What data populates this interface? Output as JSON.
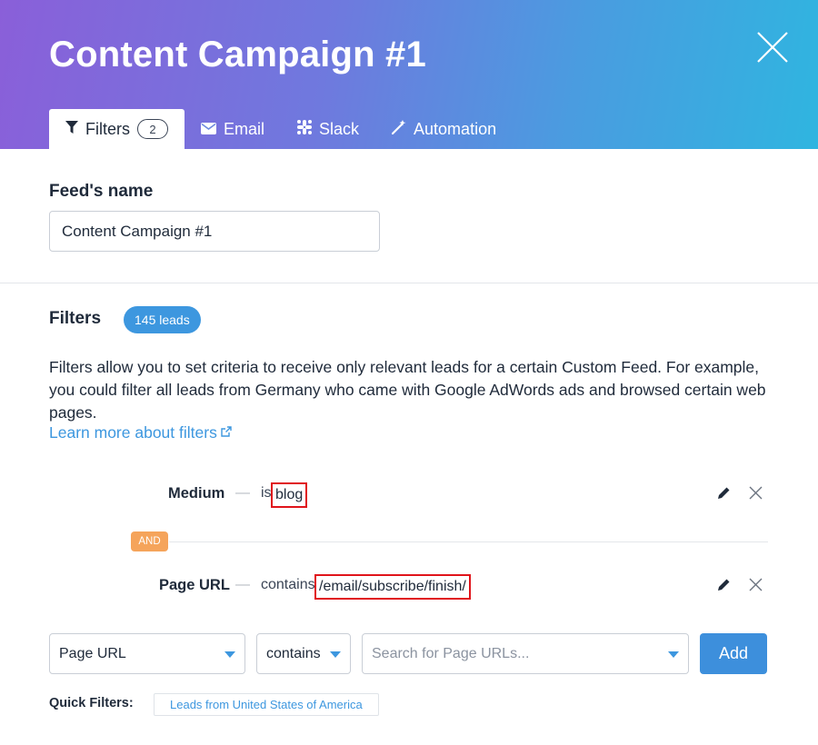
{
  "header": {
    "title": "Content Campaign #1",
    "gradient_colors": [
      "#8a5fd9",
      "#4a9ce0",
      "#2fb5e0"
    ],
    "close_icon": "close-icon"
  },
  "tabs": [
    {
      "label": "Filters",
      "icon": "filter-icon",
      "badge": "2",
      "active": true
    },
    {
      "label": "Email",
      "icon": "envelope-icon",
      "active": false
    },
    {
      "label": "Slack",
      "icon": "slack-icon",
      "active": false
    },
    {
      "label": "Automation",
      "icon": "magic-wand-icon",
      "active": false
    }
  ],
  "feed": {
    "label": "Feed's name",
    "value": "Content Campaign #1"
  },
  "filters": {
    "title": "Filters",
    "leads_badge": "145 leads",
    "description": "Filters allow you to set criteria to receive only relevant leads for a certain Custom Feed. For example, you could filter all leads from Germany who came with Google AdWords ads and browsed certain web pages.",
    "learn_more": "Learn more about filters",
    "rules": [
      {
        "field": "Medium",
        "dash": "—",
        "operator": "is",
        "value": "blog"
      },
      {
        "field": "Page URL",
        "dash": "—",
        "operator": "contains",
        "value": "/email/subscribe/finish/"
      }
    ],
    "connector": "AND"
  },
  "builder": {
    "field_select": "Page URL",
    "operator_select": "contains",
    "search_placeholder": "Search for Page URLs...",
    "add_label": "Add"
  },
  "quick_filters": {
    "label": "Quick Filters:",
    "chips": [
      "Leads from United States of America"
    ]
  },
  "colors": {
    "accent": "#3d97df",
    "and_badge": "#f5a45b",
    "highlight_border": "#e0141b"
  }
}
